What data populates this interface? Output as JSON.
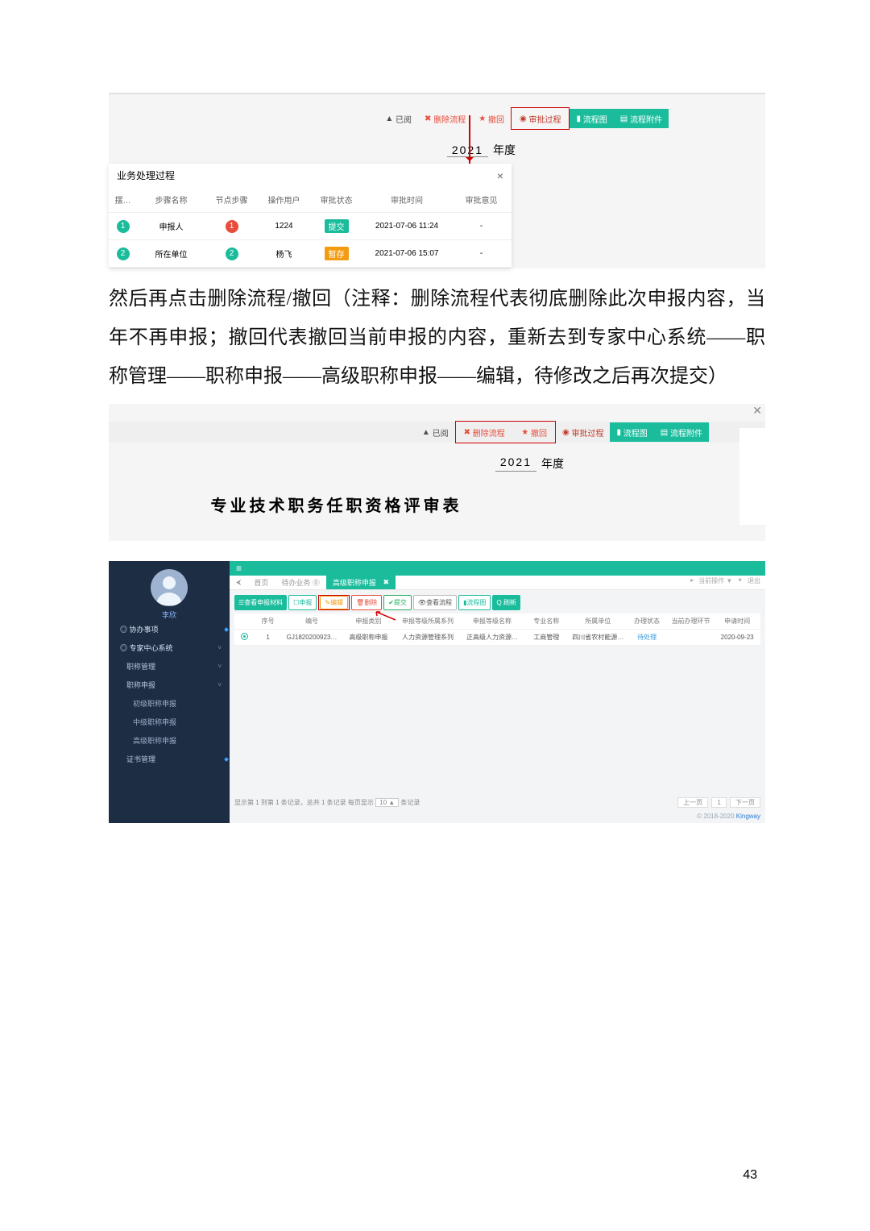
{
  "page_number": "43",
  "body_text": "然后再点击删除流程/撤回（注释：删除流程代表彻底删除此次申报内容，当年不再申报；撤回代表撤回当前申报的内容，重新去到专家中心系统——职称管理——职称申报——高级职称申报——编辑，待修改之后再次提交）",
  "shot1": {
    "toolbar": {
      "read": "已阅",
      "delete_flow": "删除流程",
      "recall": "撤回",
      "approve_process": "审批过程",
      "flow_chart": "流程图",
      "flow_attach": "流程附件"
    },
    "icons": {
      "read": "▲",
      "delete_flow": "✖",
      "recall": "★",
      "approve_process": "◉",
      "flow_chart": "▮",
      "flow_attach": "▤"
    },
    "year_value": "2021",
    "year_label": "年度",
    "modal": {
      "title": "业务处理过程",
      "close": "×",
      "cols": [
        "摆…",
        "步骤名称",
        "节点步骤",
        "操作用户",
        "审批状态",
        "审批时间",
        "审批意见"
      ],
      "rows": [
        {
          "idx_color": "teal",
          "idx": "1",
          "name": "申报人",
          "node_color": "red",
          "node": "1",
          "user": "1224",
          "status_style": "teal",
          "status": "提交",
          "time": "2021-07-06 11:24",
          "opinion": "-"
        },
        {
          "idx_color": "teal",
          "idx": "2",
          "name": "所在单位",
          "node_color": "teal",
          "node": "2",
          "user": "杨飞",
          "status_style": "orange",
          "status": "暂存",
          "time": "2021-07-06 15:07",
          "opinion": "-"
        }
      ]
    }
  },
  "shot2": {
    "toolbar": {
      "read": "已阅",
      "delete_flow": "删除流程",
      "recall": "撤回",
      "approve_process": "审批过程",
      "flow_chart": "流程图",
      "flow_attach": "流程附件"
    },
    "icons": {
      "read": "▲",
      "delete_flow": "✖",
      "recall": "★",
      "approve_process": "◉",
      "flow_chart": "▮",
      "flow_attach": "▤"
    },
    "year_value": "2021",
    "year_label": "年度",
    "doc_title": "专业技术职务任职资格评审表"
  },
  "shot3": {
    "me": "李欣",
    "nav": {
      "xt": "◎ 协办事项",
      "zx": "◎ 专家中心系统",
      "zcgl": "职称管理",
      "zcsb": "职称申报",
      "cjsb": "初级职称申报",
      "zjsb": "中级职称申报",
      "gjsb": "高级职称申报",
      "zsgl": "证书管理"
    },
    "tabs": {
      "home_glyph": "⮜",
      "home": "首页",
      "db": "待办业务 ⓪",
      "active": "高级职称申报",
      "x": "✖"
    },
    "crumbs": {
      "c1": "当前操作 ▼",
      "c2": "退出",
      "g1": "▸",
      "g2": "✦"
    },
    "acts": {
      "view": {
        "pre": "☰",
        "t": "查看申报材料"
      },
      "apply": {
        "pre": "☐",
        "t": "申报"
      },
      "edit": {
        "pre": "✎",
        "t": "编辑"
      },
      "del": {
        "pre": "🗑",
        "t": "删除"
      },
      "sub": {
        "pre": "✔",
        "t": "提交"
      },
      "look": {
        "pre": "👁",
        "t": "查看流程"
      },
      "wf": {
        "pre": "▮",
        "t": "流程图"
      },
      "ref": {
        "pre": "Q",
        "t": "刷新"
      }
    },
    "cols": [
      "",
      "序号",
      "编号",
      "申报类别",
      "申报等级所属系列",
      "申报等级名称",
      "专业名称",
      "所属单位",
      "办理状态",
      "当前办理环节",
      "申请时间"
    ],
    "row": {
      "seq": "1",
      "code": "GJ1820200923…",
      "type": "高级职称申报",
      "series": "人力资源管理系列",
      "level": "正高级人力资源…",
      "major": "工商管理",
      "org": "四川省农村能源…",
      "status": "待处理",
      "node": "",
      "date": "2020-09-23"
    },
    "pager": {
      "text_a": "显示第 1 到第 1 条记录，总共 1 条记录 每页显示",
      "sel": "10 ▲",
      "text_b": "条记录",
      "prev": "上一页",
      "pg": "1",
      "next": "下一页"
    },
    "footer_a": "© 2018-2020 ",
    "footer_b": "Kingway"
  }
}
